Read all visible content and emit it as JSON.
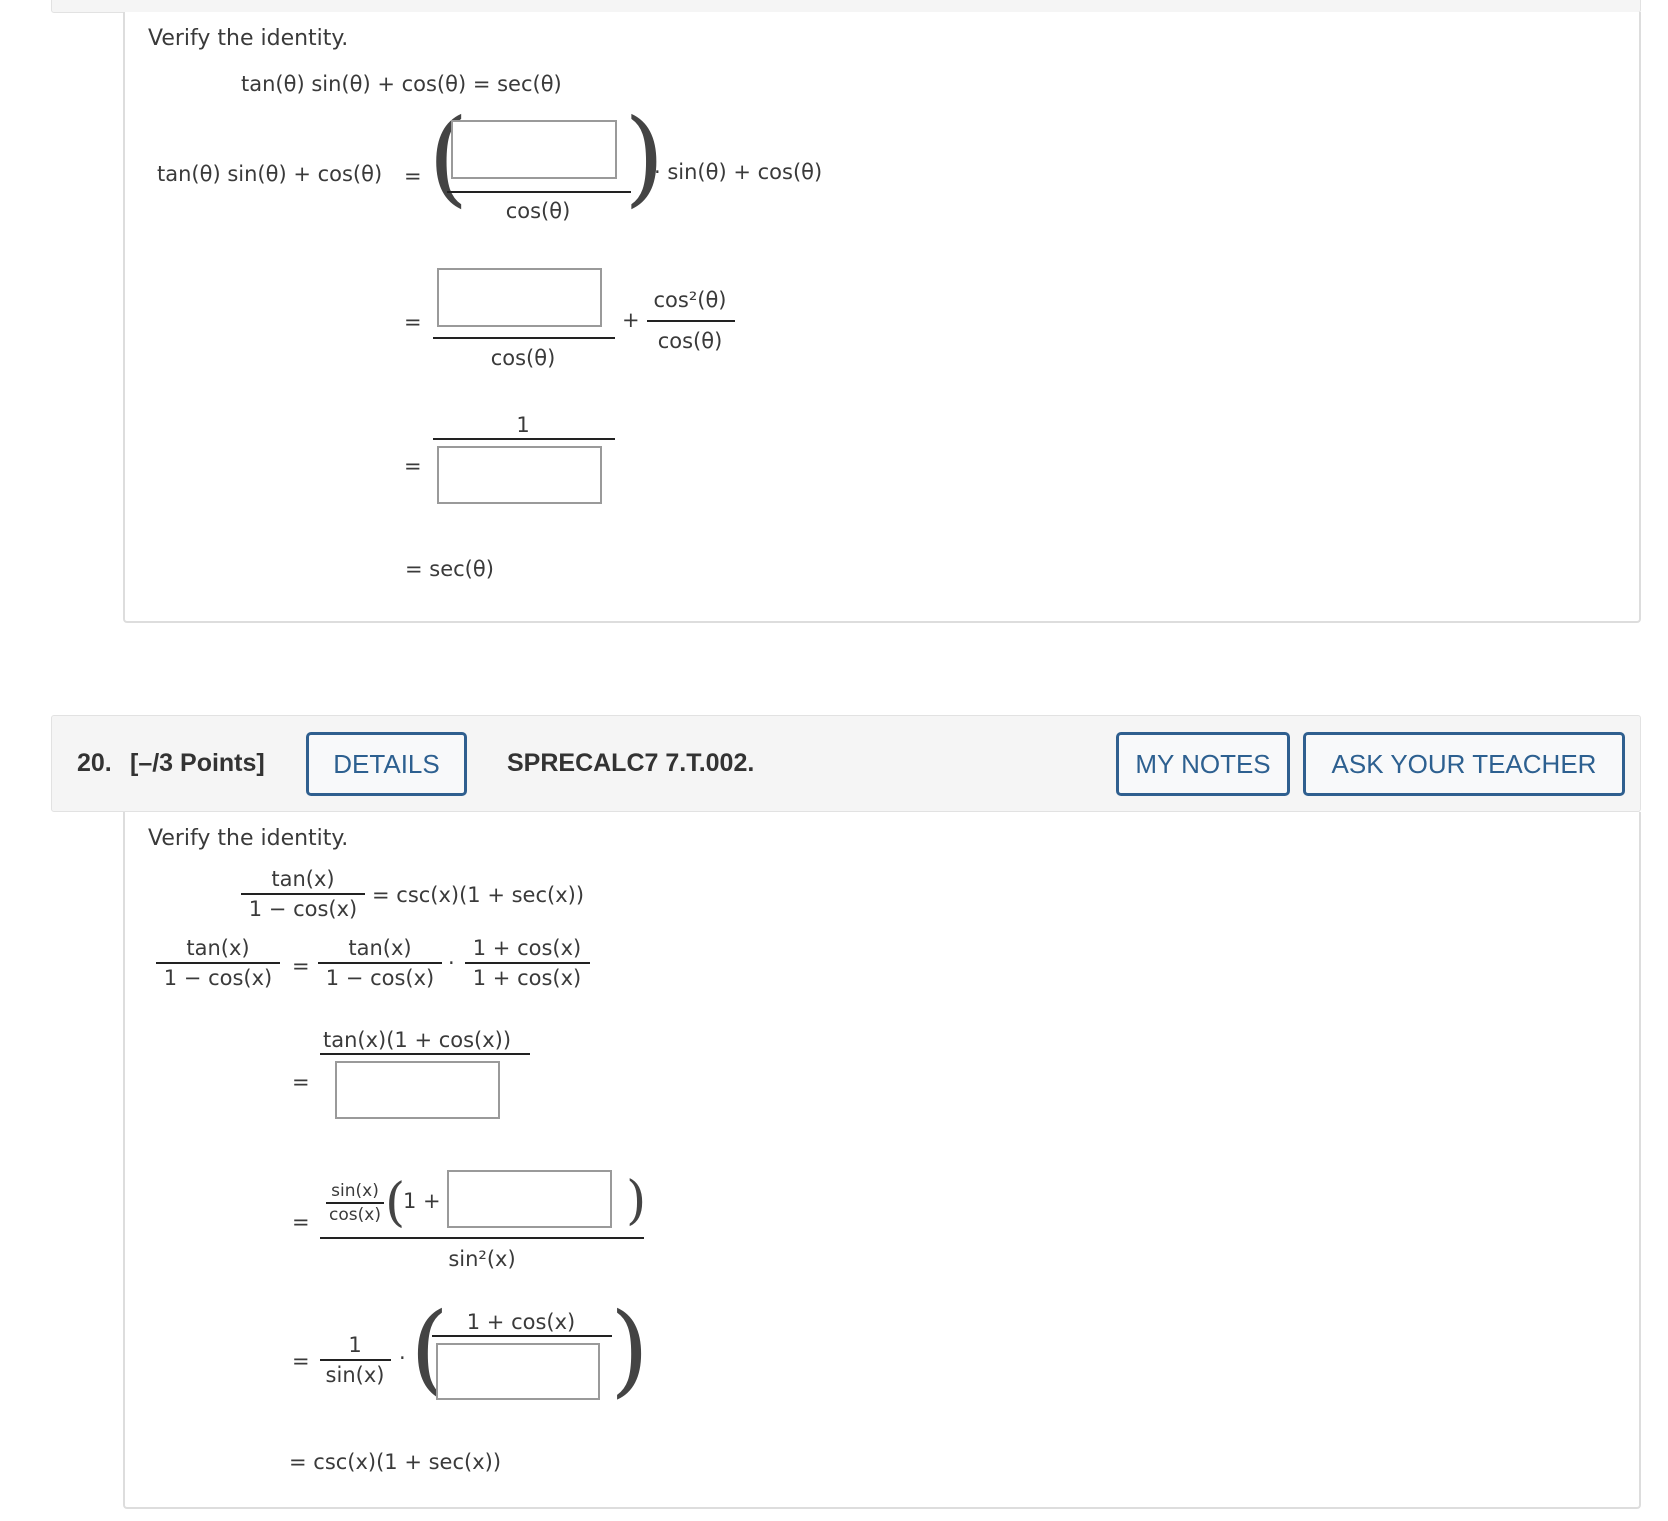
{
  "problem_19": {
    "instruction": "Verify the identity.",
    "identity": "tan(θ) sin(θ) + cos(θ) = sec(θ)",
    "row1": {
      "lhs": "tan(θ) sin(θ) + cos(θ)",
      "eq": "=",
      "denominator": "cos(θ)",
      "after": "· sin(θ) + cos(θ)",
      "input_value": ""
    },
    "row2": {
      "eq": "=",
      "denominator": "cos(θ)",
      "plus": "+",
      "frac_num": "cos²(θ)",
      "frac_den": "cos(θ)",
      "input_value": ""
    },
    "row3": {
      "eq": "=",
      "numerator": "1",
      "input_value": ""
    },
    "row4": {
      "result": "= sec(θ)"
    }
  },
  "problem_20": {
    "header": {
      "number": "20.",
      "points": "[–/3 Points]",
      "details_button": "DETAILS",
      "problem_id": "SPRECALC7 7.T.002.",
      "my_notes_button": "MY NOTES",
      "ask_teacher_button": "ASK YOUR TEACHER"
    },
    "instruction": "Verify the identity.",
    "identity": {
      "num": "tan(x)",
      "den": "1 − cos(x)",
      "rhs": "= csc(x)(1 + sec(x))"
    },
    "row1": {
      "lhs_num": "tan(x)",
      "lhs_den": "1 − cos(x)",
      "eq": "=",
      "f1_num": "tan(x)",
      "f1_den": "1 − cos(x)",
      "dot": "·",
      "f2_num": "1 + cos(x)",
      "f2_den": "1 + cos(x)"
    },
    "row2": {
      "eq": "=",
      "numerator": "tan(x)(1 + cos(x))",
      "input_value": ""
    },
    "row3": {
      "eq": "=",
      "small_num": "sin(x)",
      "small_den": "cos(x)",
      "one_plus": "1 +",
      "denominator": "sin²(x)",
      "input_value": ""
    },
    "row4": {
      "eq": "=",
      "f_num": "1",
      "f_den": "sin(x)",
      "dot": "·",
      "inner_num": "1 + cos(x)",
      "input_value": ""
    },
    "row5": {
      "result": "= csc(x)(1 + sec(x))"
    }
  },
  "colors": {
    "button_border": "#2f5f8f",
    "button_text": "#2d6090",
    "header_bg": "#f5f5f5",
    "input_border": "#9a9a9a"
  }
}
